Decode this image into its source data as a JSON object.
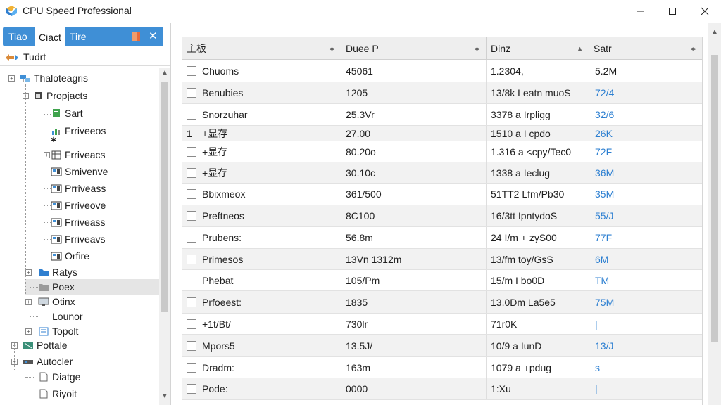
{
  "window": {
    "title": "CPU Speed Professional",
    "icon": "cpu-speed-app-icon",
    "accent": "#3f8fd6"
  },
  "left_pane": {
    "tabs": [
      {
        "label": "Tiao",
        "active": false
      },
      {
        "label": "Ciact",
        "active": true
      },
      {
        "label": "Tire",
        "active": false
      }
    ],
    "tab_close": "✕",
    "header_label": "Tudrt",
    "tree": [
      {
        "label": "Thaloteagris",
        "icon": "network-icon"
      },
      {
        "label": "Propjacts",
        "icon": "chip-icon"
      },
      {
        "label": "Sart",
        "icon": "green-doc-icon"
      },
      {
        "label": "Frriveeos",
        "icon": "chart-icon"
      },
      {
        "label": "Frriveacs",
        "icon": "table-icon"
      },
      {
        "label": "Smivenve",
        "icon": "panel-icon"
      },
      {
        "label": "Prriveass",
        "icon": "panel-icon"
      },
      {
        "label": "Frriveove",
        "icon": "panel-icon"
      },
      {
        "label": "Frriveass",
        "icon": "panel-icon"
      },
      {
        "label": "Frriveavs",
        "icon": "panel-icon"
      },
      {
        "label": "Orfire",
        "icon": "panel-icon"
      },
      {
        "label": "Ratys",
        "icon": "folder-blue-icon"
      },
      {
        "label": "Poex",
        "icon": "folder-gray-icon"
      },
      {
        "label": "Otinx",
        "icon": "monitor-icon"
      },
      {
        "label": "Lounor",
        "icon": "blank-icon"
      },
      {
        "label": "Topolt",
        "icon": "list-icon"
      },
      {
        "label": "Pottale",
        "icon": "board-icon"
      },
      {
        "label": "Autocler",
        "icon": "device-icon"
      },
      {
        "label": "Diatge",
        "icon": "doc-icon"
      },
      {
        "label": "Riyoit",
        "icon": "doc-icon"
      }
    ],
    "tree_extra_glyph": "✱"
  },
  "grid": {
    "columns": [
      "主板",
      "Duee P",
      "Dinz",
      "Satr"
    ],
    "rows": [
      {
        "marker": "box",
        "c0": "Chuoms",
        "c1": "45061",
        "c2": "1.2304,",
        "c3": "5.2M",
        "c3_dark": true
      },
      {
        "marker": "box",
        "c0": "Benubies",
        "c1": "1205",
        "c2": "13/8k Leatn muoS",
        "c3": "72/4"
      },
      {
        "marker": "box",
        "c0": "Snorzuhar",
        "c1": "25.3Vr",
        "c2": "3378 a Irpligg",
        "c3": "32/6"
      },
      {
        "marker": "1",
        "c0": "+显存",
        "c1": "27.00",
        "c2": "1510 a I cpdo",
        "c3": "26K"
      },
      {
        "marker": "box",
        "c0": "+显存",
        "c1": "80.20o",
        "c2": "1.316 a <cpy/Tec0",
        "c3": "72F"
      },
      {
        "marker": "box",
        "c0": "+显存",
        "c1": "30.10c",
        "c2": "1338 a Ieclug",
        "c3": "36M"
      },
      {
        "marker": "box",
        "c0": "Bbixmeox",
        "c1": "361/500",
        "c2": "51TT2 Lfm/Pb30",
        "c3": "35M"
      },
      {
        "marker": "box",
        "c0": "Preftneos",
        "c1": "8C100",
        "c2": "16/3tt IpntydoS",
        "c3": "55/J"
      },
      {
        "marker": "box",
        "c0": "Prubens:",
        "c1": "56.8m",
        "c2": "24 I/m + zyS00",
        "c3": "77F"
      },
      {
        "marker": "box",
        "c0": "Primesos",
        "c1": "13Vn 1312m",
        "c2": "13/fm toy/GsS",
        "c3": "6M"
      },
      {
        "marker": "box",
        "c0": "Phebat",
        "c1": "105/Pm",
        "c2": "15/m I bo0D",
        "c3": "TM"
      },
      {
        "marker": "box",
        "c0": "Prfoeest:",
        "c1": "1835",
        "c2": "13.0Dm La5e5",
        "c3": "75M"
      },
      {
        "marker": "box",
        "c0": "+1t/Bt/",
        "c1": "730lr",
        "c2": "71r0K",
        "c3": "|"
      },
      {
        "marker": "box",
        "c0": "Mpors5",
        "c1": "13.5J/",
        "c2": "10/9 a IunD",
        "c3": "13/J"
      },
      {
        "marker": "box",
        "c0": "Dradm:",
        "c1": "163m",
        "c2": "1079 a +pdug",
        "c3": "s"
      },
      {
        "marker": "box",
        "c0": "Pode:",
        "c1": "0000",
        "c2": "1:Xu",
        "c3": "|"
      }
    ]
  }
}
